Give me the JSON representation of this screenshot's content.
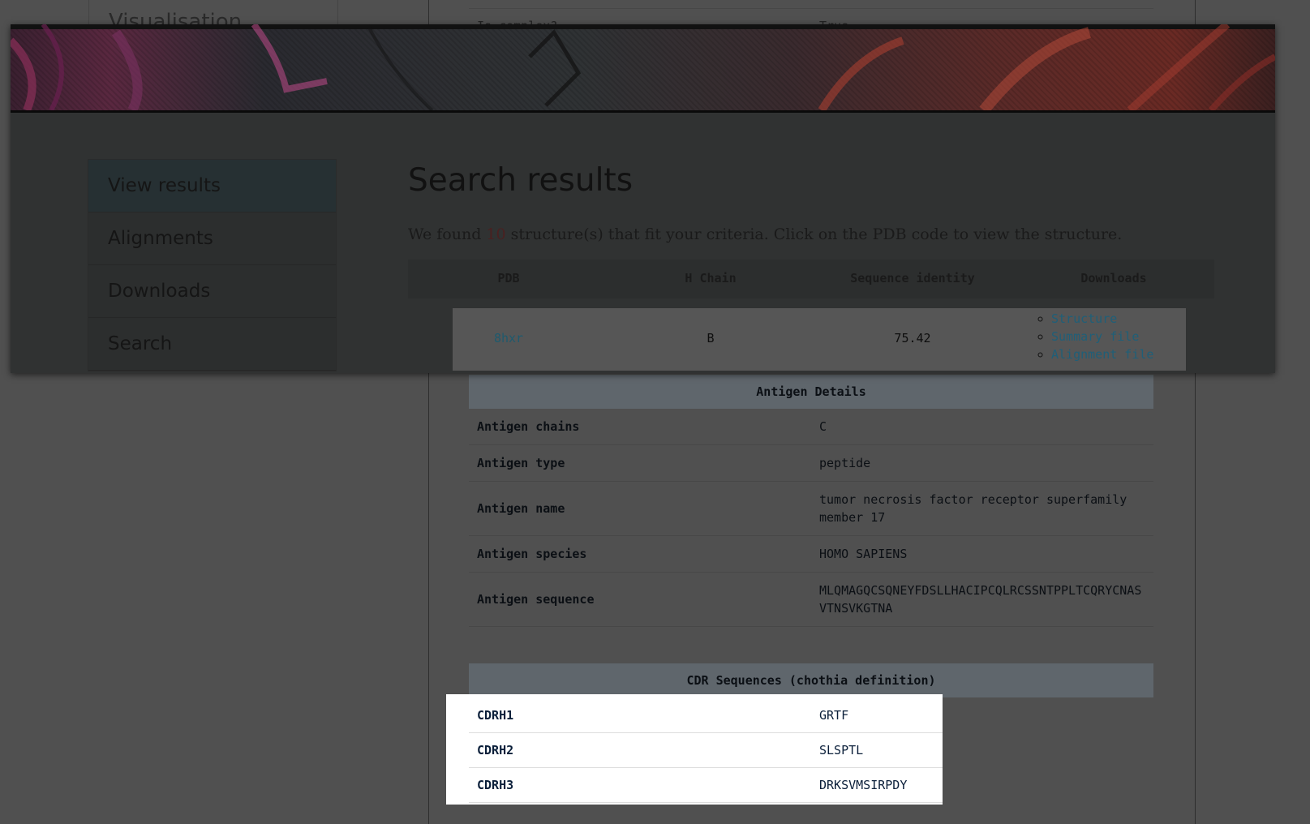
{
  "underlying": {
    "sidebar_title": "Visualisation",
    "top_row": {
      "label": "Is complex?",
      "value": "True"
    },
    "antigen_table": {
      "header": "Antigen Details",
      "rows": [
        {
          "label": "Antigen chains",
          "value": "C"
        },
        {
          "label": "Antigen type",
          "value": "peptide"
        },
        {
          "label": "Antigen name",
          "value": "tumor necrosis factor receptor superfamily member 17"
        },
        {
          "label": "Antigen species",
          "value": "HOMO SAPIENS"
        },
        {
          "label": "Antigen sequence",
          "value": "MLQMAGQCSQNEYFDSLLHACIPCQLRCSSNTPPLTCQRYCNASVTNSVKGTNA"
        }
      ]
    },
    "cdr_table": {
      "header": "CDR Sequences (chothia definition)",
      "rows": [
        {
          "label": "CDRH1",
          "value": "GRTF"
        },
        {
          "label": "CDRH2",
          "value": "SLSPTL"
        },
        {
          "label": "CDRH3",
          "value": "DRKSVMSIRPDY"
        }
      ]
    }
  },
  "overlay": {
    "menu": [
      {
        "label": "View results",
        "active": true
      },
      {
        "label": "Alignments"
      },
      {
        "label": "Downloads"
      },
      {
        "label": "Search"
      }
    ],
    "title": "Search results",
    "subtitle": {
      "prefix": "We found ",
      "count": "10",
      "suffix": " structure(s) that fit your criteria. Click on the PDB code to view the structure."
    },
    "table": {
      "headers": [
        "PDB",
        "H Chain",
        "Sequence identity",
        "Downloads"
      ],
      "row": {
        "pdb": "8hxr",
        "h_chain": "B",
        "identity": "75.42",
        "downloads": [
          "Structure",
          "Summary file",
          "Alignment file"
        ]
      }
    }
  },
  "colors": {
    "page_bg": "#505050",
    "overlay_bg": "#303232",
    "table_header_bg": "#5f666c",
    "link": "#1f5f78",
    "highlight_bg": "#ffffff"
  }
}
